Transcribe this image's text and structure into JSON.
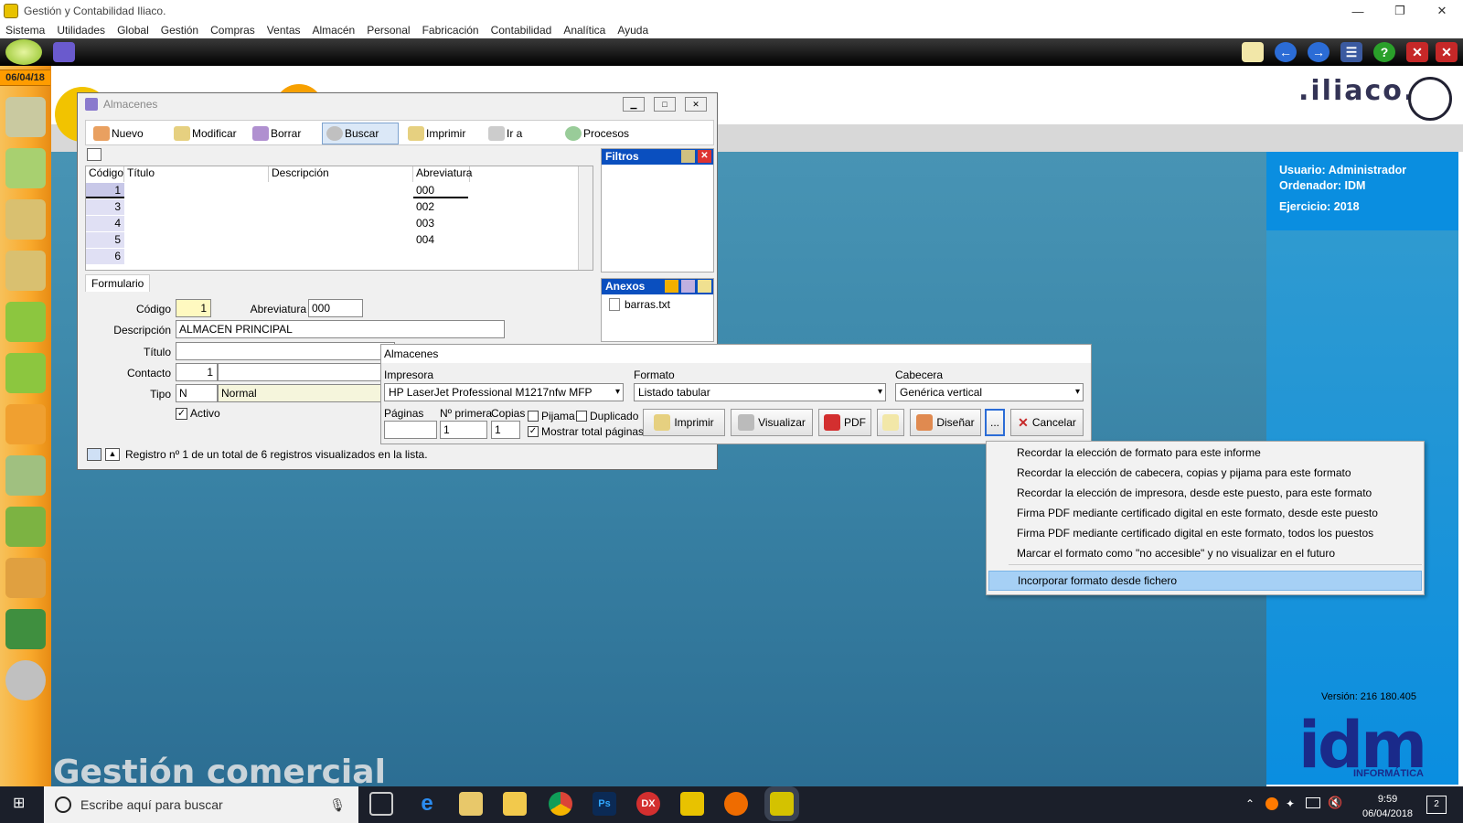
{
  "window_title": "Gestión y Contabilidad Iliaco.",
  "menu": [
    "Sistema",
    "Utilidades",
    "Global",
    "Gestión",
    "Compras",
    "Ventas",
    "Almacén",
    "Personal",
    "Fabricación",
    "Contabilidad",
    "Analítica",
    "Ayuda"
  ],
  "date": "06/04/18",
  "brand_logo": ".iliaco.",
  "user": {
    "usuario": "Usuario: Administrador",
    "ordenador": "Ordenador: IDM",
    "ejercicio": "Ejercicio: 2018"
  },
  "version": "Versión: 216 180.405",
  "idm": {
    "big": "idm",
    "sub": "INFORMÁTICA"
  },
  "watermark": "Gestión comercial",
  "almacenes_window": {
    "title": "Almacenes",
    "tools": [
      "Nuevo",
      "Modificar",
      "Borrar",
      "Buscar",
      "Imprimir",
      "Ir a",
      "Procesos"
    ],
    "columns": [
      "Código",
      "Título",
      "Descripción",
      "Abreviatura"
    ],
    "rows": [
      {
        "codigo": "1",
        "abrev": "000"
      },
      {
        "codigo": "3",
        "abrev": "002"
      },
      {
        "codigo": "4",
        "abrev": "003"
      },
      {
        "codigo": "5",
        "abrev": "004"
      },
      {
        "codigo": "6",
        "abrev": ""
      }
    ],
    "filtros": "Filtros",
    "anexos": "Anexos",
    "anexo_file": "barras.txt",
    "form_tab": "Formulario",
    "labels": {
      "codigo": "Código",
      "abrev": "Abreviatura",
      "descripcion": "Descripción",
      "titulo": "Título",
      "contacto": "Contacto",
      "tipo": "Tipo",
      "activo": "Activo"
    },
    "values": {
      "codigo": "1",
      "abrev": "000",
      "descripcion": "ALMACEN PRINCIPAL",
      "contacto": "1",
      "tipo_code": "N",
      "tipo": "Normal"
    },
    "status": "Registro nº 1 de un total de 6 registros visualizados en la lista."
  },
  "print_dialog": {
    "title": "Almacenes",
    "impresora_label": "Impresora",
    "impresora": "HP LaserJet Professional M1217nfw MFP",
    "formato_label": "Formato",
    "formato": "Listado tabular",
    "cabecera_label": "Cabecera",
    "cabecera": "Genérica vertical",
    "paginas_label": "Páginas",
    "primera_label": "Nº primera",
    "primera": "1",
    "copias_label": "Copias",
    "copias": "1",
    "pijama": "Pijama",
    "duplicado": "Duplicado",
    "mostrar": "Mostrar total páginas",
    "btn_imprimir": "Imprimir",
    "btn_visualizar": "Visualizar",
    "btn_pdf": "PDF",
    "btn_disenar": "Diseñar",
    "btn_more": "...",
    "btn_cancelar": "Cancelar"
  },
  "context_menu": [
    "Recordar la elección de formato para este informe",
    "Recordar la elección de cabecera, copias y pijama para este formato",
    "Recordar la elección de impresora, desde este puesto, para este formato",
    "Firma PDF mediante certificado digital en este formato, desde este puesto",
    "Firma PDF mediante certificado digital en este formato, todos los puestos",
    "Marcar el formato como \"no accesible\" y no visualizar en el futuro",
    "Incorporar formato desde fichero"
  ],
  "taskbar": {
    "search": "Escribe aquí para buscar",
    "time": "9:59",
    "date": "06/04/2018",
    "notif": "2"
  }
}
